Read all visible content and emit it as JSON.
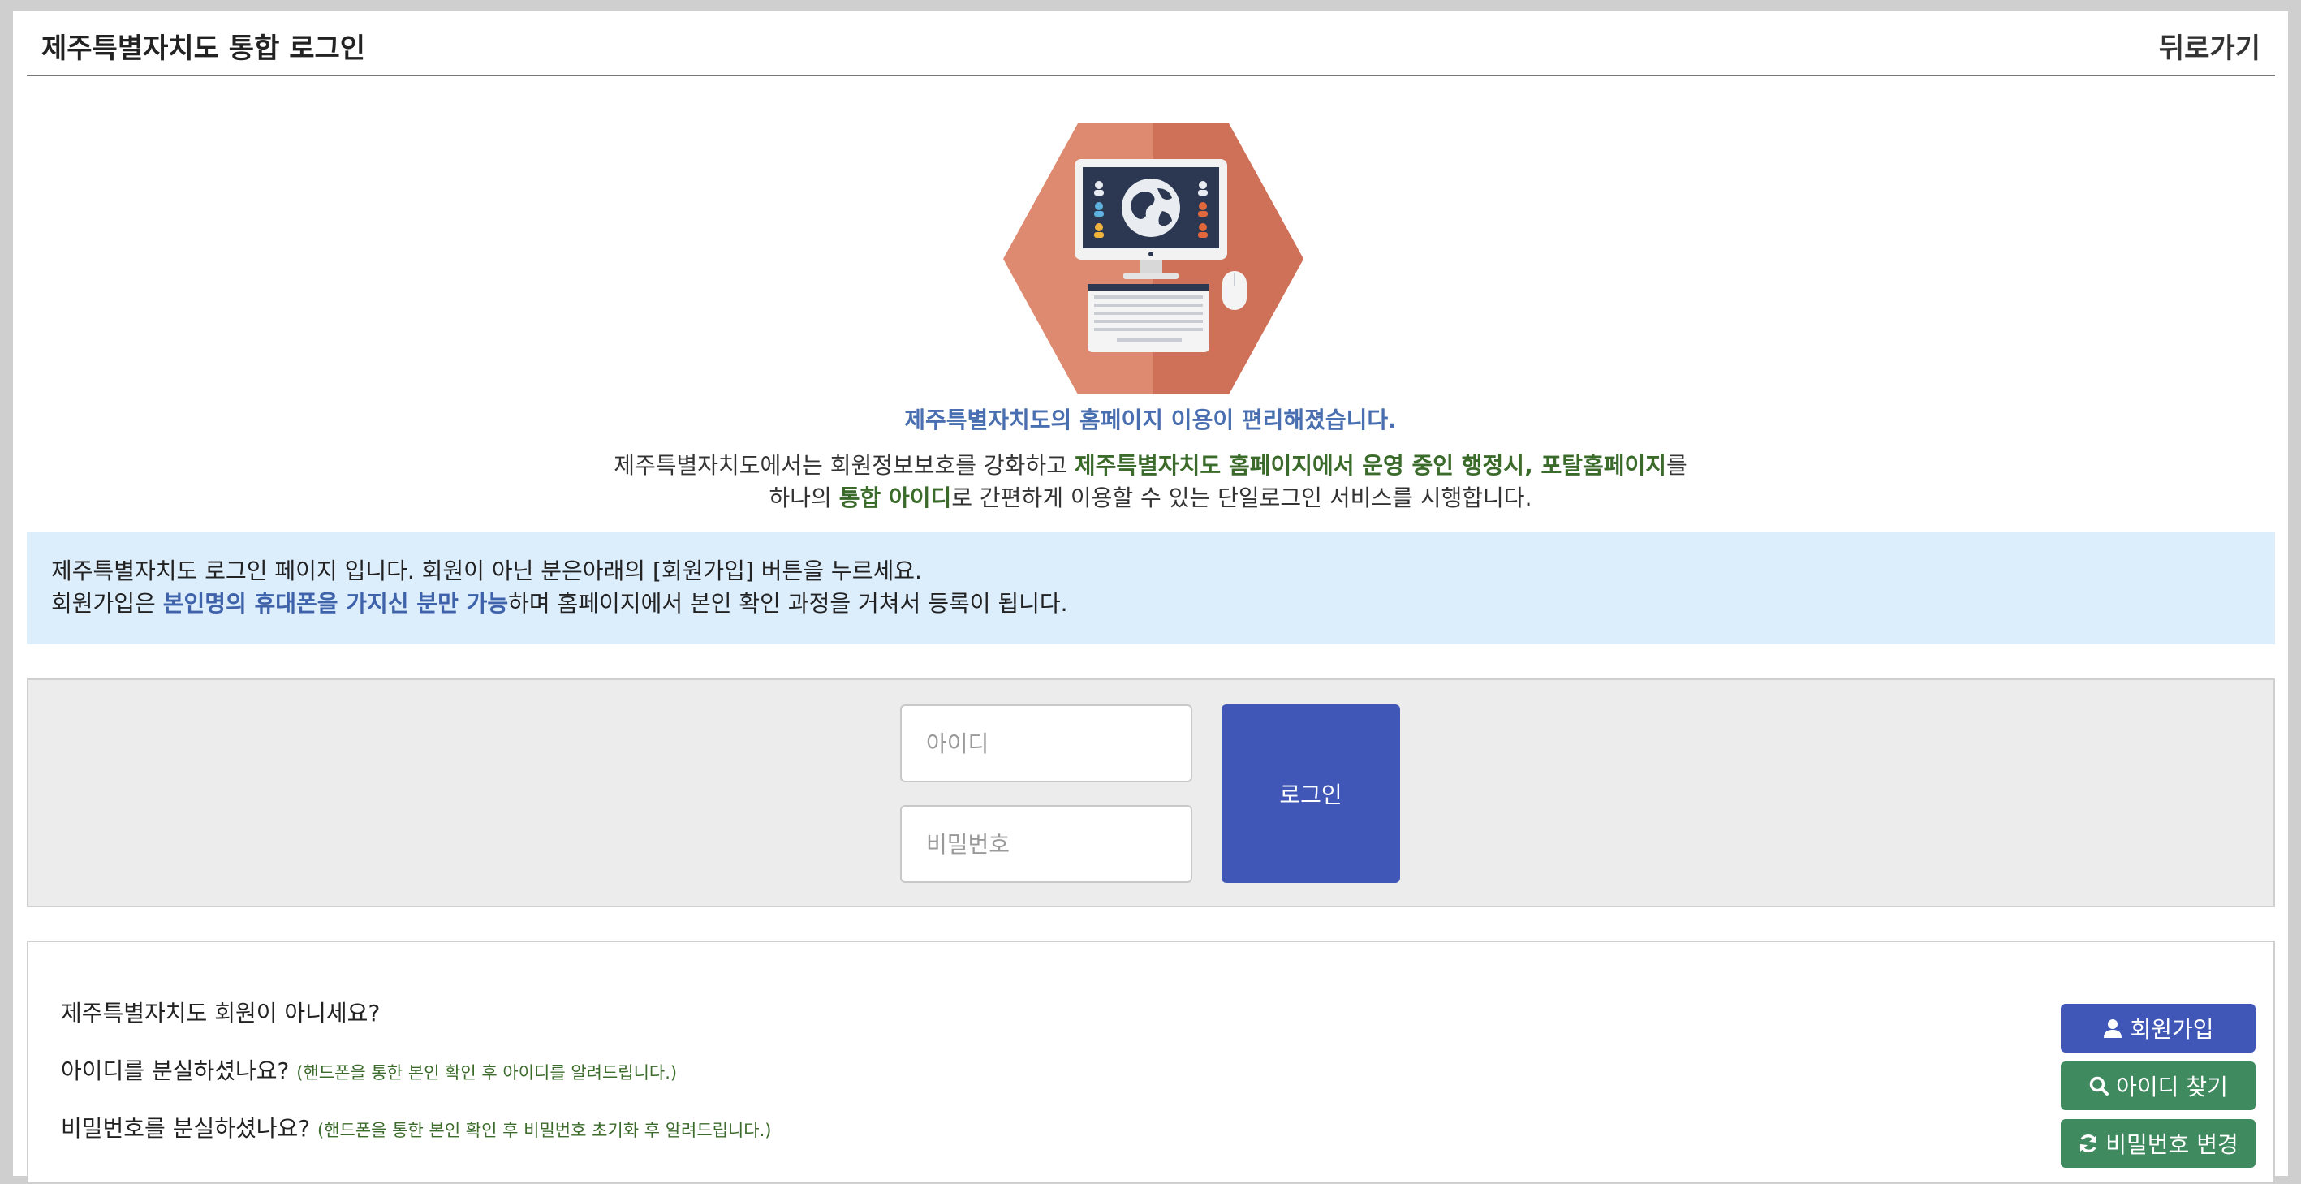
{
  "header": {
    "title": "제주특별자치도 통합 로그인",
    "back_label": "뒤로가기"
  },
  "hero": {
    "headline": "제주특별자치도의 홈페이지 이용이 편리해졌습니다.",
    "line1_a": "제주특별자치도에서는 회원정보보호를 강화하고 ",
    "line1_b": "제주특별자치도 홈페이지에서 운영 중인 행정시, 포탈홈페이지",
    "line1_c": "를",
    "line2_a": "하나의 ",
    "line2_b": "통합 아이디",
    "line2_c": "로 간편하게 이용할 수 있는 단일로그인 서비스를 시행합니다."
  },
  "notice": {
    "line1": "제주특별자치도 로그인 페이지 입니다. 회원이 아닌 분은아래의 [회원가입] 버튼을 누르세요.",
    "line2_a": "회원가입은 ",
    "line2_b": "본인명의 휴대폰을 가지신 분만 가능",
    "line2_c": "하며 홈페이지에서 본인 확인 과정을 거쳐서 등록이 됩니다."
  },
  "login": {
    "id_placeholder": "아이디",
    "id_value": "",
    "pw_placeholder": "비밀번호",
    "pw_value": "",
    "submit_label": "로그인"
  },
  "help": {
    "not_member": "제주특별자치도 회원이 아니세요?",
    "lost_id": "아이디를 분실하셨나요?",
    "lost_id_note": "(핸드폰을 통한 본인 확인 후 아이디를 알려드립니다.)",
    "lost_pw": "비밀번호를 분실하셨나요?",
    "lost_pw_note": "(핸드폰을 통한 본인 확인 후 비밀번호 초기화 후 알려드립니다.)",
    "join_label": "회원가입",
    "find_id_label": "아이디 찾기",
    "change_pw_label": "비밀번호 변경"
  },
  "colors": {
    "primary": "#4057b8",
    "success": "#3f8a5f",
    "notice_bg": "#dcedfc",
    "hero_orange": "#d9826a"
  },
  "icons": {
    "join": "user-icon",
    "find_id": "search-icon",
    "change_pw": "refresh-icon"
  }
}
